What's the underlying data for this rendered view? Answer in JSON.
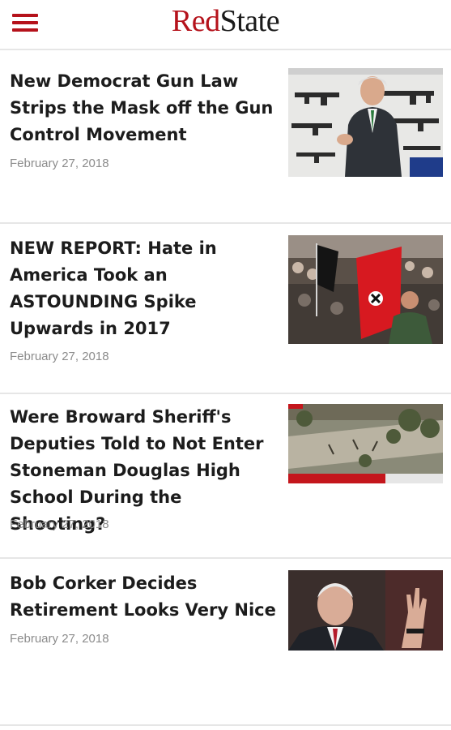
{
  "header": {
    "logo_red": "Red",
    "logo_dark": "State"
  },
  "articles": [
    {
      "headline": "New Democrat Gun Law Strips the Mask off the Gun Control Movement",
      "date": "February 27, 2018",
      "image": "man-speaking-before-rifle-display"
    },
    {
      "headline": "NEW REPORT: Hate in America Took an ASTOUNDING Spike Upwards in 2017",
      "date": "February 27, 2018",
      "image": "rally-crowd-with-flags"
    },
    {
      "headline": "Were Broward Sheriff's Deputies Told to Not Enter Stoneman Douglas High School During the Shooting?",
      "date": "February 27, 2018",
      "image": "aerial-news-footage-school"
    },
    {
      "headline": "Bob Corker Decides Retirement Looks Very Nice",
      "date": "February 27, 2018",
      "image": "senator-waving-portrait"
    }
  ],
  "colors": {
    "brand_red": "#b5121b",
    "headline_text": "#1c1c1c",
    "date_text": "#8c8c8c",
    "divider": "#e6e6e6"
  }
}
